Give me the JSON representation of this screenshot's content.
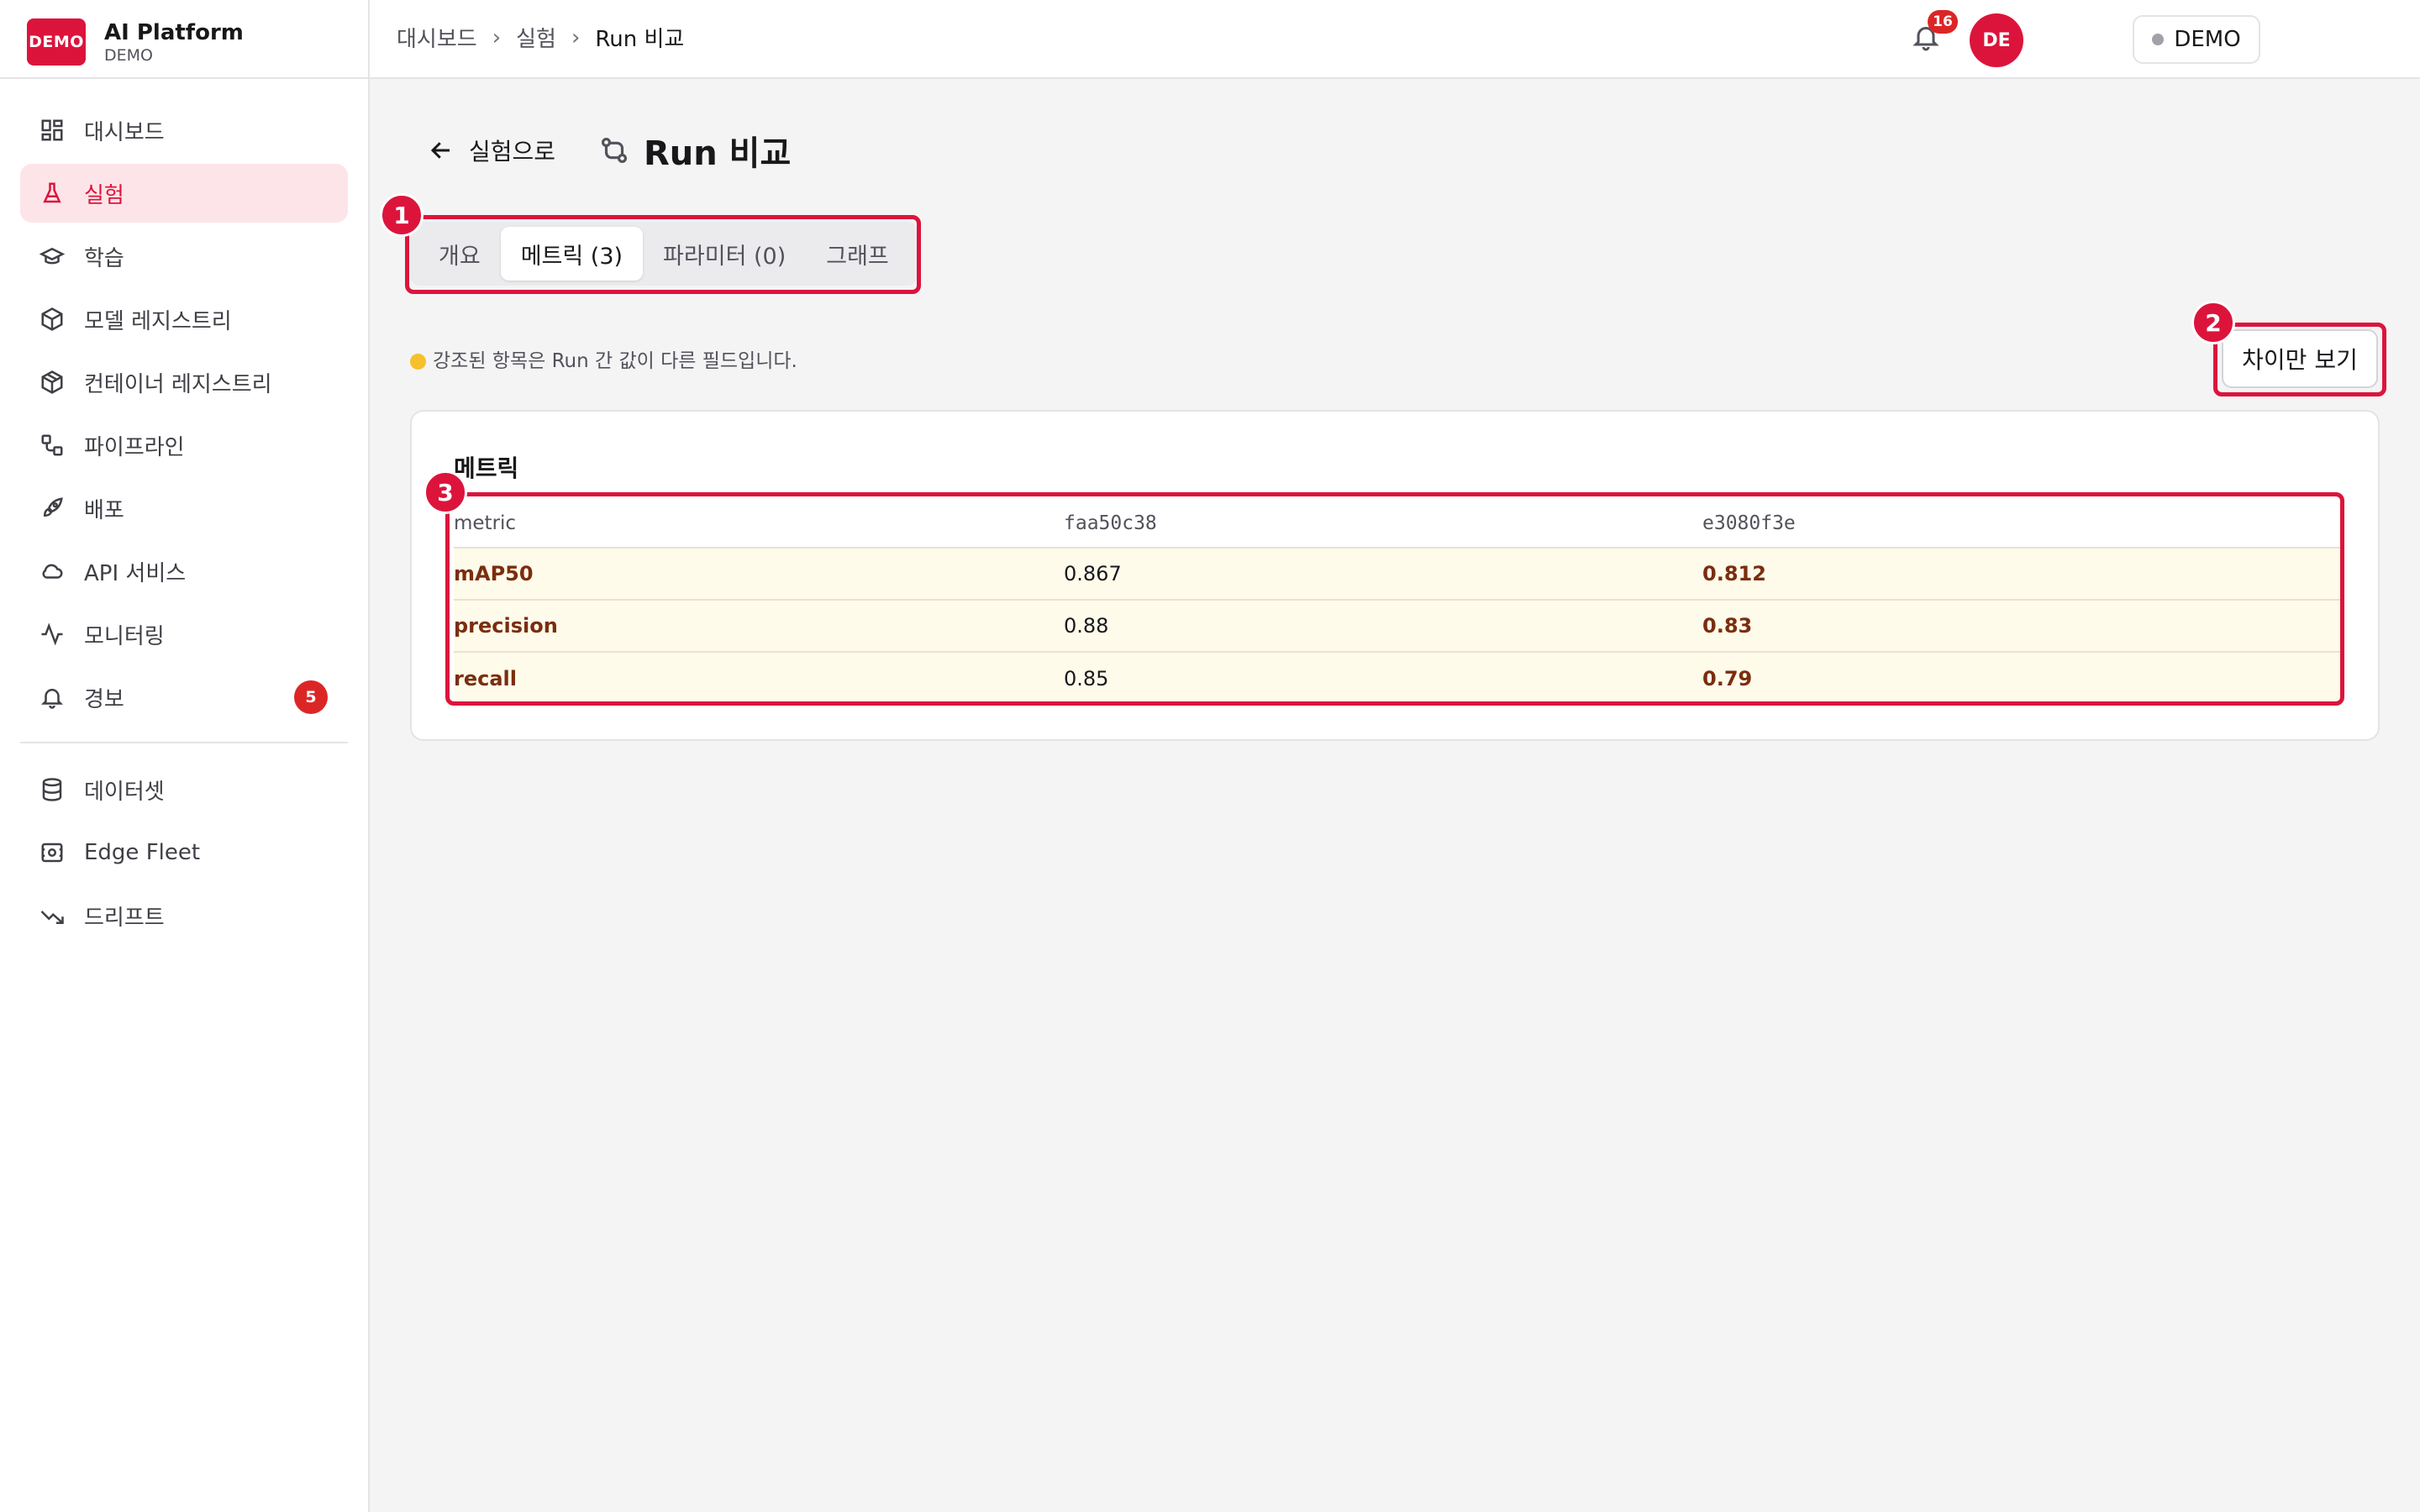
{
  "brand": {
    "logo": "DEMO",
    "title": "AI Platform",
    "subtitle": "DEMO"
  },
  "sidebar": {
    "items": [
      {
        "label": "대시보드",
        "icon": "dashboard-icon"
      },
      {
        "label": "실험",
        "icon": "flask-icon",
        "active": true
      },
      {
        "label": "학습",
        "icon": "graduation-cap-icon"
      },
      {
        "label": "모델 레지스트리",
        "icon": "box-icon"
      },
      {
        "label": "컨테이너 레지스트리",
        "icon": "package-icon"
      },
      {
        "label": "파이프라인",
        "icon": "workflow-icon"
      },
      {
        "label": "배포",
        "icon": "rocket-icon"
      },
      {
        "label": "API 서비스",
        "icon": "cloud-icon"
      },
      {
        "label": "모니터링",
        "icon": "activity-icon"
      },
      {
        "label": "경보",
        "icon": "bell-icon",
        "badge": "5"
      }
    ],
    "secondary": [
      {
        "label": "데이터셋",
        "icon": "database-icon"
      },
      {
        "label": "Edge Fleet",
        "icon": "cpu-icon"
      },
      {
        "label": "드리프트",
        "icon": "trending-down-icon"
      }
    ]
  },
  "topbar": {
    "breadcrumb": [
      "대시보드",
      "실험",
      "Run 비교"
    ],
    "env_label": "DEMO",
    "notifications": "16",
    "avatar": "DE"
  },
  "page": {
    "back_label": "실험으로",
    "title": "Run 비교",
    "tabs": [
      "개요",
      "메트릭 (3)",
      "파라미터 (0)",
      "그래프"
    ],
    "active_tab": 1,
    "hint": "강조된 항목은 Run 간 값이 다른 필드입니다.",
    "diff_button": "차이만 보기"
  },
  "metrics": {
    "title": "메트릭",
    "columns": [
      "metric",
      "faa50c38",
      "e3080f3e"
    ],
    "rows": [
      {
        "name": "mAP50",
        "a": "0.867",
        "b": "0.812"
      },
      {
        "name": "precision",
        "a": "0.88",
        "b": "0.83"
      },
      {
        "name": "recall",
        "a": "0.85",
        "b": "0.79"
      }
    ]
  },
  "annotations": [
    "1",
    "2",
    "3"
  ],
  "colors": {
    "accent": "#dc143c",
    "highlight_bg": "#fffbeb",
    "diff_text": "#7a2e0e",
    "hint_dot": "#f6c02c"
  }
}
